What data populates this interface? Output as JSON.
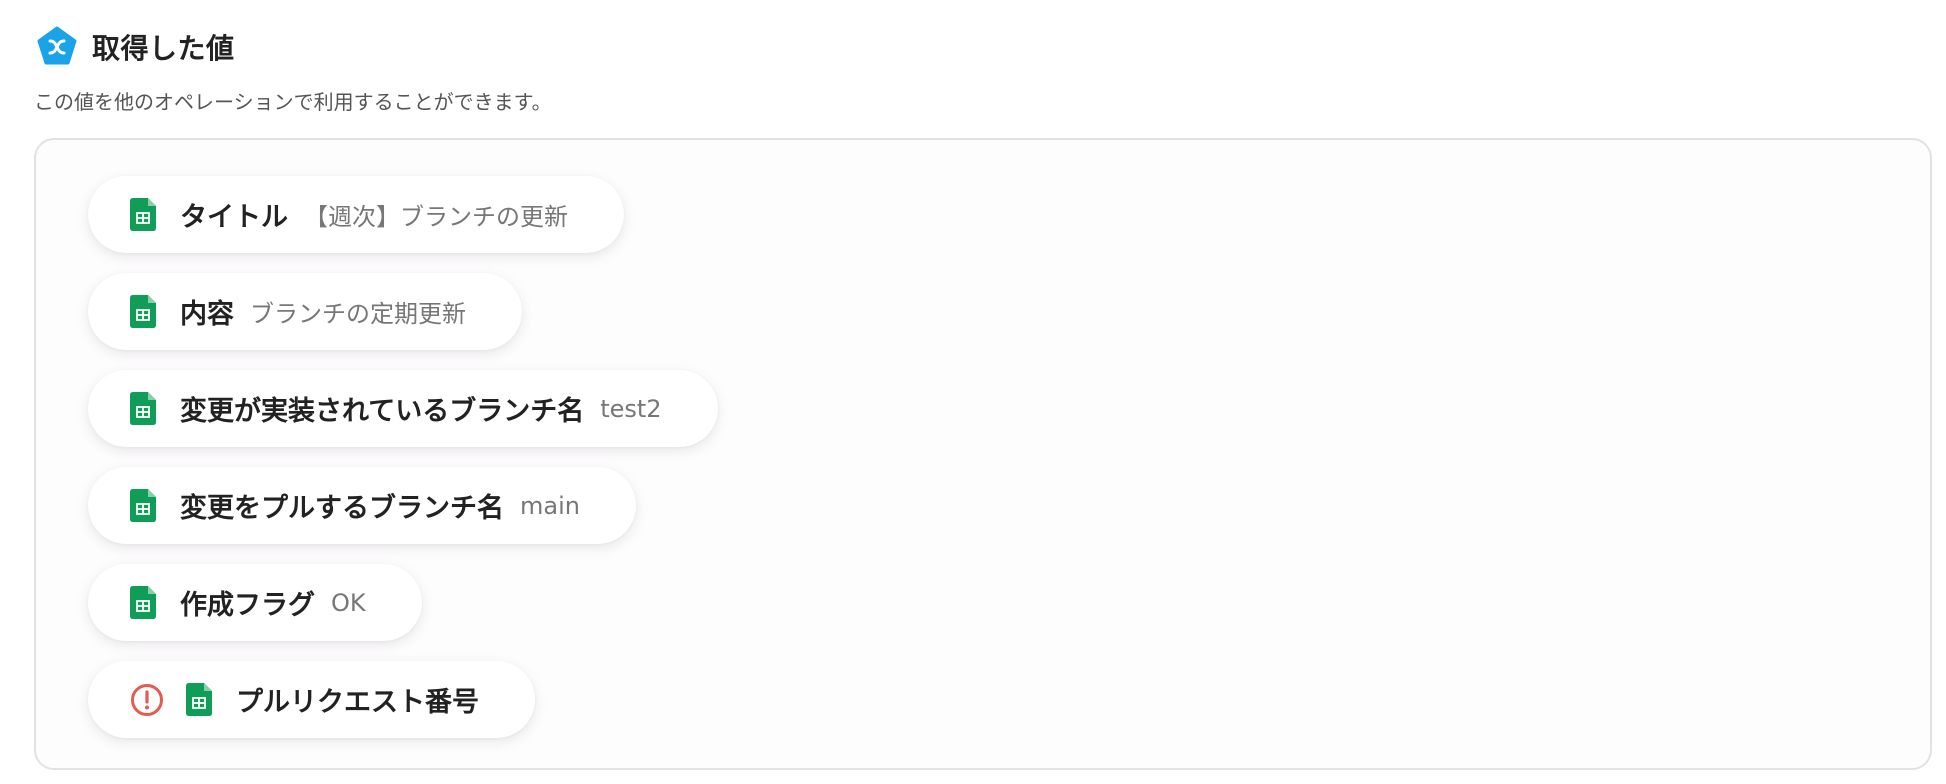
{
  "header": {
    "title": "取得した値",
    "description": "この値を他のオペレーションで利用することができます。",
    "icon": "brand-logo-icon",
    "accent_color": "#1aa3e8"
  },
  "values": {
    "items": [
      {
        "label": "タイトル",
        "value": "【週次】ブランチの更新",
        "icon": "spreadsheet-icon"
      },
      {
        "label": "内容",
        "value": "ブランチの定期更新",
        "icon": "spreadsheet-icon"
      },
      {
        "label": "変更が実装されているブランチ名",
        "value": "test2",
        "icon": "spreadsheet-icon"
      },
      {
        "label": "変更をプルするブランチ名",
        "value": "main",
        "icon": "spreadsheet-icon"
      },
      {
        "label": "作成フラグ",
        "value": "OK",
        "icon": "spreadsheet-icon"
      },
      {
        "label": "プルリクエスト番号",
        "value": "",
        "icon": "spreadsheet-icon",
        "status_icon": "alert-icon"
      }
    ],
    "sheet_icon_color": "#0f9d58",
    "alert_color": "#e35b52"
  }
}
